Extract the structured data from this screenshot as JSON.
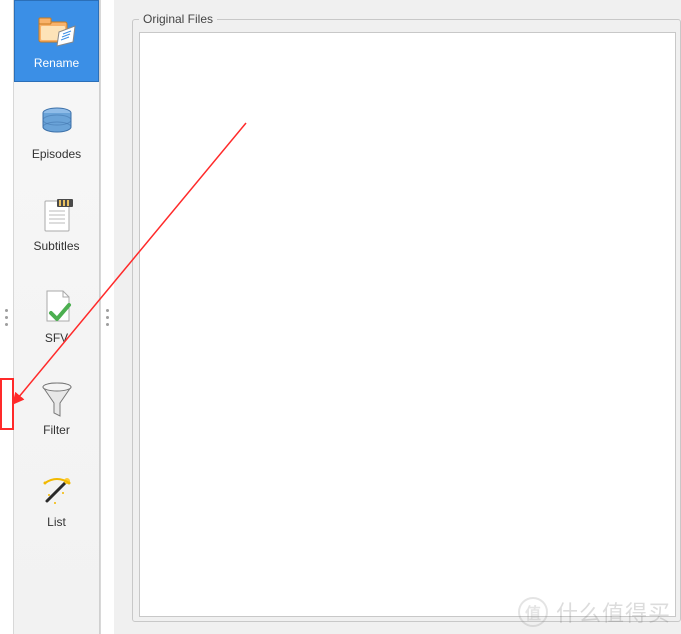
{
  "sidebar": {
    "items": [
      {
        "label": "Rename",
        "selected": true
      },
      {
        "label": "Episodes",
        "selected": false
      },
      {
        "label": "Subtitles",
        "selected": false
      },
      {
        "label": "SFV",
        "selected": false
      },
      {
        "label": "Filter",
        "selected": false
      },
      {
        "label": "List",
        "selected": false
      }
    ]
  },
  "panel": {
    "title": "Original Files"
  },
  "watermark": {
    "logo_char": "值",
    "text": "什么值得买"
  },
  "annotation": {
    "arrow_color": "#ff2a2a"
  }
}
